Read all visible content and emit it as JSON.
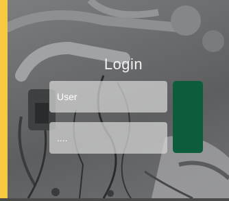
{
  "login": {
    "title": "Login",
    "username_placeholder": "User",
    "password_value": "....",
    "submit_label": ""
  },
  "colors": {
    "accent_green": "#0d5c3c",
    "frame_yellow": "#f7c940"
  }
}
